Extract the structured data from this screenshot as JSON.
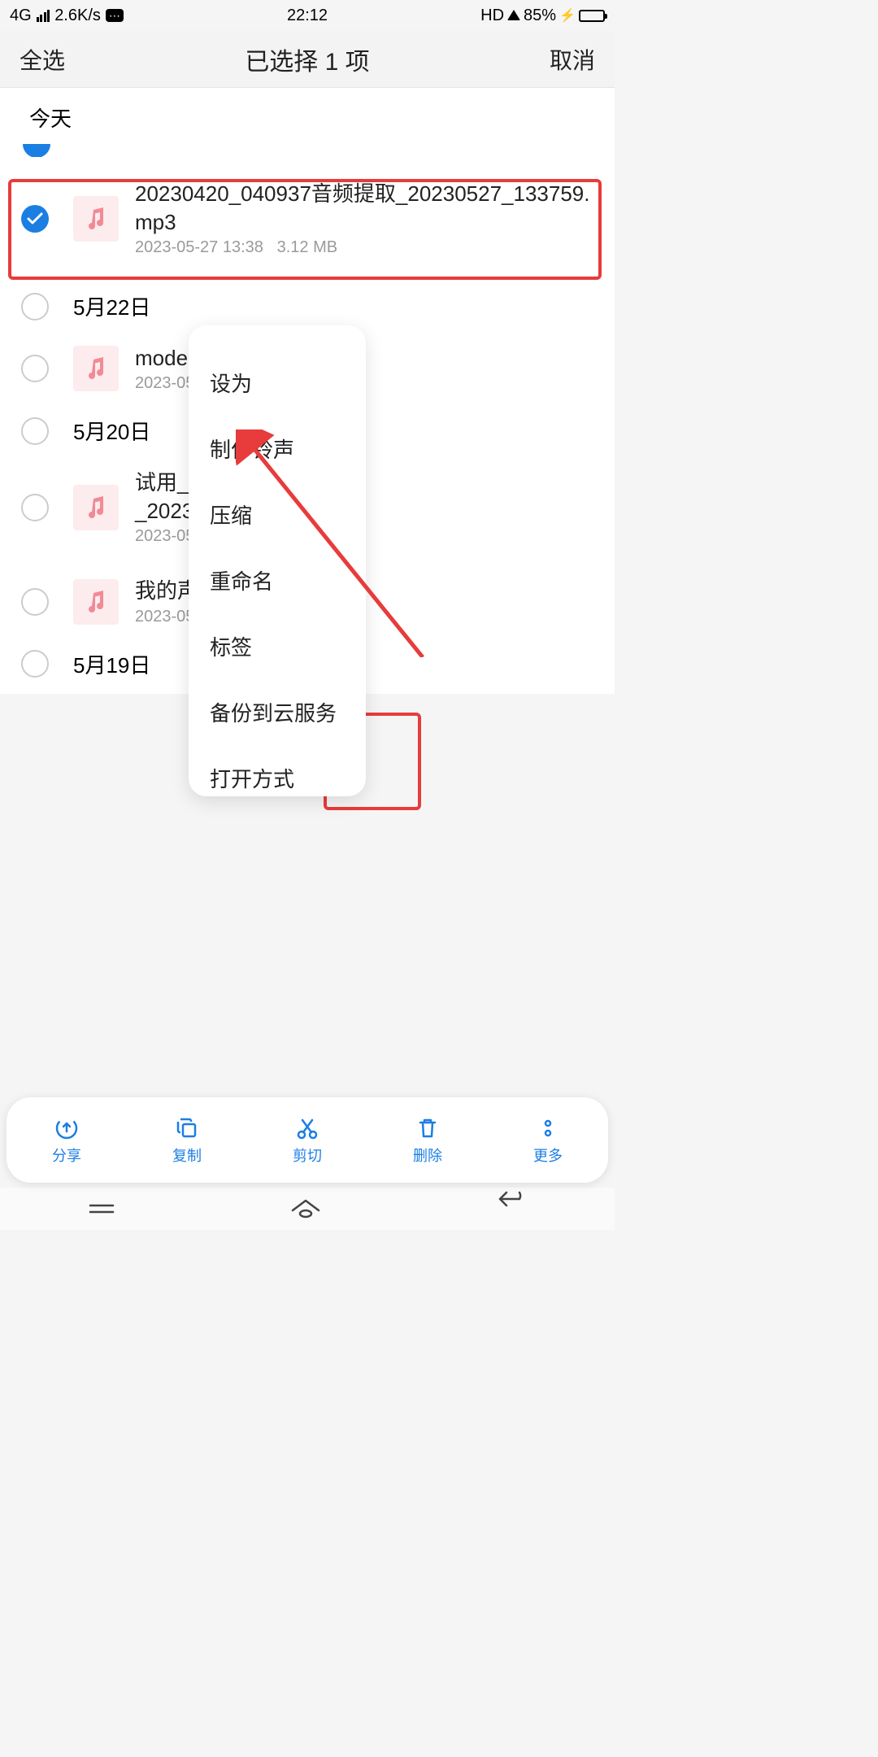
{
  "status": {
    "network": "4G",
    "speed": "2.6K/s",
    "time": "22:12",
    "hd": "HD",
    "battery_pct": "85%"
  },
  "header": {
    "select_all": "全选",
    "title": "已选择 1 项",
    "cancel": "取消"
  },
  "section_today": "今天",
  "files": {
    "item1": {
      "name": "20230420_040937音频提取_20230527_133759.mp3",
      "date": "2023-05-27 13:38",
      "size": "3.12 MB"
    },
    "date_5_22": "5月22日",
    "item2": {
      "name_partial": "mode",
      "date_partial": "2023-05"
    },
    "date_5_20": "5月20日",
    "item3": {
      "name_partial1": "试用_",
      "name_partial2": "_2023",
      "date_partial": "2023-05"
    },
    "item4": {
      "name_partial": "我的声",
      "date_partial": "2023-05"
    },
    "date_5_19": "5月19日"
  },
  "popup": {
    "set_as": "设为",
    "make_ringtone": "制作铃声",
    "compress": "压缩",
    "rename": "重命名",
    "tags": "标签",
    "backup_cloud": "备份到云服务",
    "open_with_partial": "打开方式"
  },
  "bottom": {
    "share": "分享",
    "copy": "复制",
    "cut": "剪切",
    "delete": "删除",
    "more": "更多"
  }
}
